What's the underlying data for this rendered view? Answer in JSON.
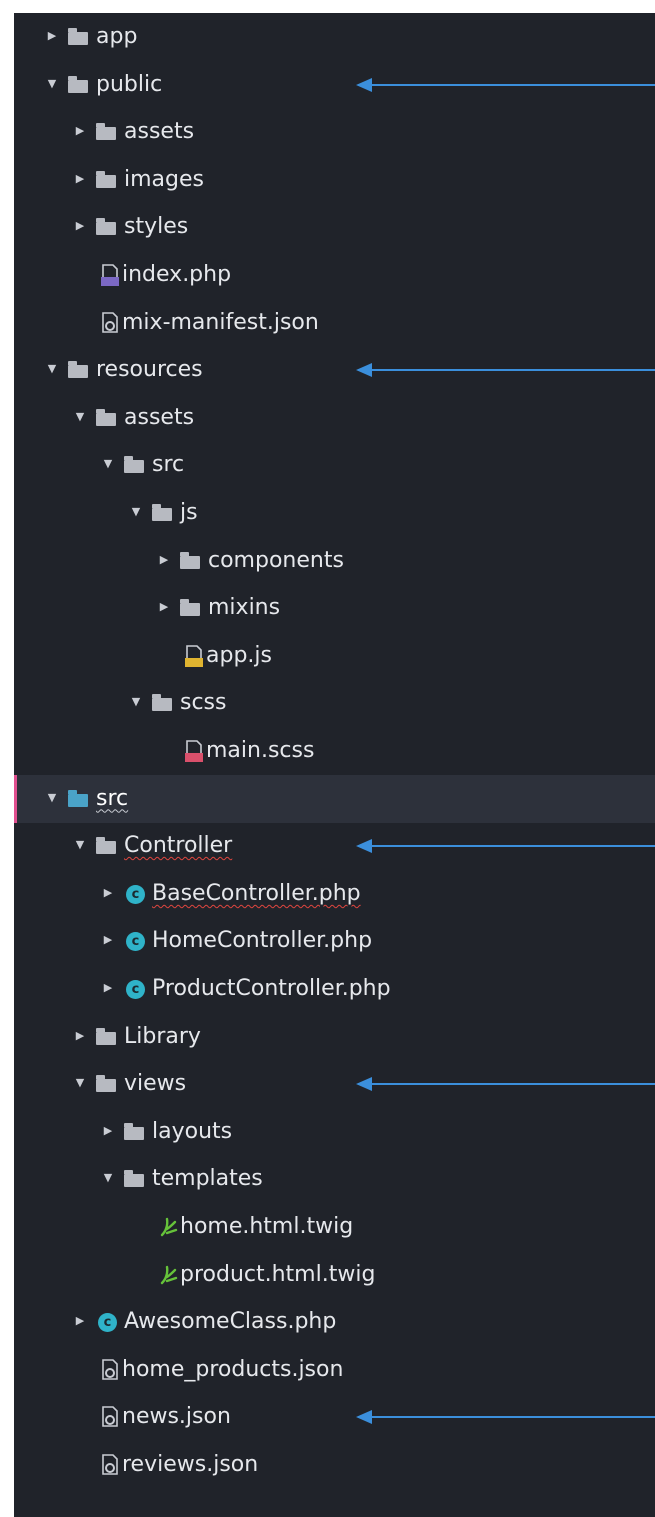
{
  "colors": {
    "background": "#20232a",
    "selection": "#2d313b",
    "selection_marker": "#e04f8f",
    "folder": "#b7bac1",
    "folder_active": "#4aa3c8",
    "class_icon": "#2fb3c9",
    "twig_icon": "#66c23a",
    "pointer": "#3b8fdc",
    "spellcheck": "#e0463f"
  },
  "tree": [
    {
      "label": "app",
      "type": "folder",
      "depth": 0,
      "expanded": false
    },
    {
      "label": "public",
      "type": "folder",
      "depth": 0,
      "expanded": true,
      "pointer": true
    },
    {
      "label": "assets",
      "type": "folder",
      "depth": 1,
      "expanded": false
    },
    {
      "label": "images",
      "type": "folder",
      "depth": 1,
      "expanded": false
    },
    {
      "label": "styles",
      "type": "folder",
      "depth": 1,
      "expanded": false
    },
    {
      "label": "index.php",
      "type": "file",
      "icon": "php-file-icon",
      "icon_label": "PHP",
      "depth": 1
    },
    {
      "label": "mix-manifest.json",
      "type": "file",
      "icon": "json-file-icon",
      "depth": 1
    },
    {
      "label": "resources",
      "type": "folder",
      "depth": 0,
      "expanded": true,
      "pointer": true
    },
    {
      "label": "assets",
      "type": "folder",
      "depth": 1,
      "expanded": true
    },
    {
      "label": "src",
      "type": "folder",
      "depth": 2,
      "expanded": true
    },
    {
      "label": "js",
      "type": "folder",
      "depth": 3,
      "expanded": true
    },
    {
      "label": "components",
      "type": "folder",
      "depth": 4,
      "expanded": false
    },
    {
      "label": "mixins",
      "type": "folder",
      "depth": 4,
      "expanded": false
    },
    {
      "label": "app.js",
      "type": "file",
      "icon": "js-file-icon",
      "icon_label": "JS",
      "depth": 4
    },
    {
      "label": "scss",
      "type": "folder",
      "depth": 3,
      "expanded": true
    },
    {
      "label": "main.scss",
      "type": "file",
      "icon": "sass-file-icon",
      "icon_label": "SASS",
      "depth": 4
    },
    {
      "label": "src",
      "type": "folder",
      "depth": 0,
      "expanded": true,
      "selected": true,
      "active": true,
      "underline": "white"
    },
    {
      "label": "Controller",
      "type": "folder",
      "depth": 1,
      "expanded": true,
      "pointer": true,
      "underline": "red"
    },
    {
      "label": "BaseController.php",
      "type": "class",
      "depth": 2,
      "expandable": true,
      "underline": "red"
    },
    {
      "label": "HomeController.php",
      "type": "class",
      "depth": 2,
      "expandable": true
    },
    {
      "label": "ProductController.php",
      "type": "class",
      "depth": 2,
      "expandable": true
    },
    {
      "label": "Library",
      "type": "folder",
      "depth": 1,
      "expanded": false
    },
    {
      "label": "views",
      "type": "folder",
      "depth": 1,
      "expanded": true,
      "pointer": true
    },
    {
      "label": "layouts",
      "type": "folder",
      "depth": 2,
      "expanded": false
    },
    {
      "label": "templates",
      "type": "folder",
      "depth": 2,
      "expanded": true
    },
    {
      "label": "home.html.twig",
      "type": "twig",
      "depth": 3
    },
    {
      "label": "product.html.twig",
      "type": "twig",
      "depth": 3
    },
    {
      "label": "AwesomeClass.php",
      "type": "class",
      "depth": 1,
      "expandable": true
    },
    {
      "label": "home_products.json",
      "type": "file",
      "icon": "json-file-icon",
      "depth": 1
    },
    {
      "label": "news.json",
      "type": "file",
      "icon": "json-file-icon",
      "depth": 1,
      "pointer": true
    },
    {
      "label": "reviews.json",
      "type": "file",
      "icon": "json-file-icon",
      "depth": 1
    }
  ]
}
